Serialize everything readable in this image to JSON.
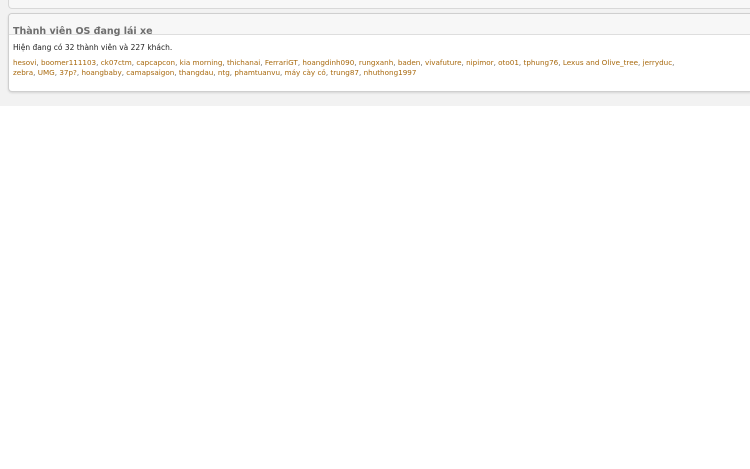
{
  "section": {
    "title": "Thành viên OS đang lái xe",
    "summary": "Hiện đang có 32 thành viên và 227 khách."
  },
  "members": [
    "hesovi",
    "boomer111103",
    "ck07ctm",
    "capcapcon",
    "kia morning",
    "thichanai",
    "FerrariGT",
    "hoangdinh090",
    "rungxanh",
    "baden",
    "vivafuture",
    "nipimor",
    "oto01",
    "tphung76",
    "Lexus and Olive_tree",
    "jerryduc",
    "zebra",
    "UMG",
    "37p?",
    "hoangbaby",
    "camapsaigon",
    "thangdau",
    "ntg",
    "phamtuanvu",
    "máy cày cỏ",
    "trung87",
    "nhuthong1997"
  ],
  "line_break_after": 16,
  "colors": {
    "link": "#a8690e",
    "title": "#6e6e6e",
    "panel_border": "#cfcfcf",
    "page_background": "#f2f2f2"
  }
}
